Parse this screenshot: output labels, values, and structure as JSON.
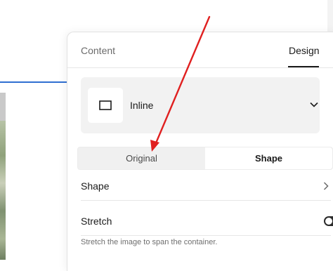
{
  "tabs": [
    {
      "label": "Content",
      "active": false
    },
    {
      "label": "Design",
      "active": true
    }
  ],
  "layout_select": {
    "selected": "Inline",
    "thumb_icon": "rectangle-outline-icon",
    "chevron_icon": "chevron-down-icon"
  },
  "segmented": {
    "options": [
      "Original",
      "Shape"
    ],
    "selected": "Shape"
  },
  "shape_row": {
    "label": "Shape",
    "chevron_icon": "chevron-right-icon"
  },
  "stretch_row": {
    "label": "Stretch",
    "toggle_on": false
  },
  "helper_text": "Stretch the image to span the container.",
  "annotation": {
    "color": "#e02020",
    "icon": "red-arrow"
  },
  "colors": {
    "link_blue": "#2f6fd1",
    "panel_grey": "#f2f2f2",
    "toggle_dark": "#2b2b2b"
  }
}
